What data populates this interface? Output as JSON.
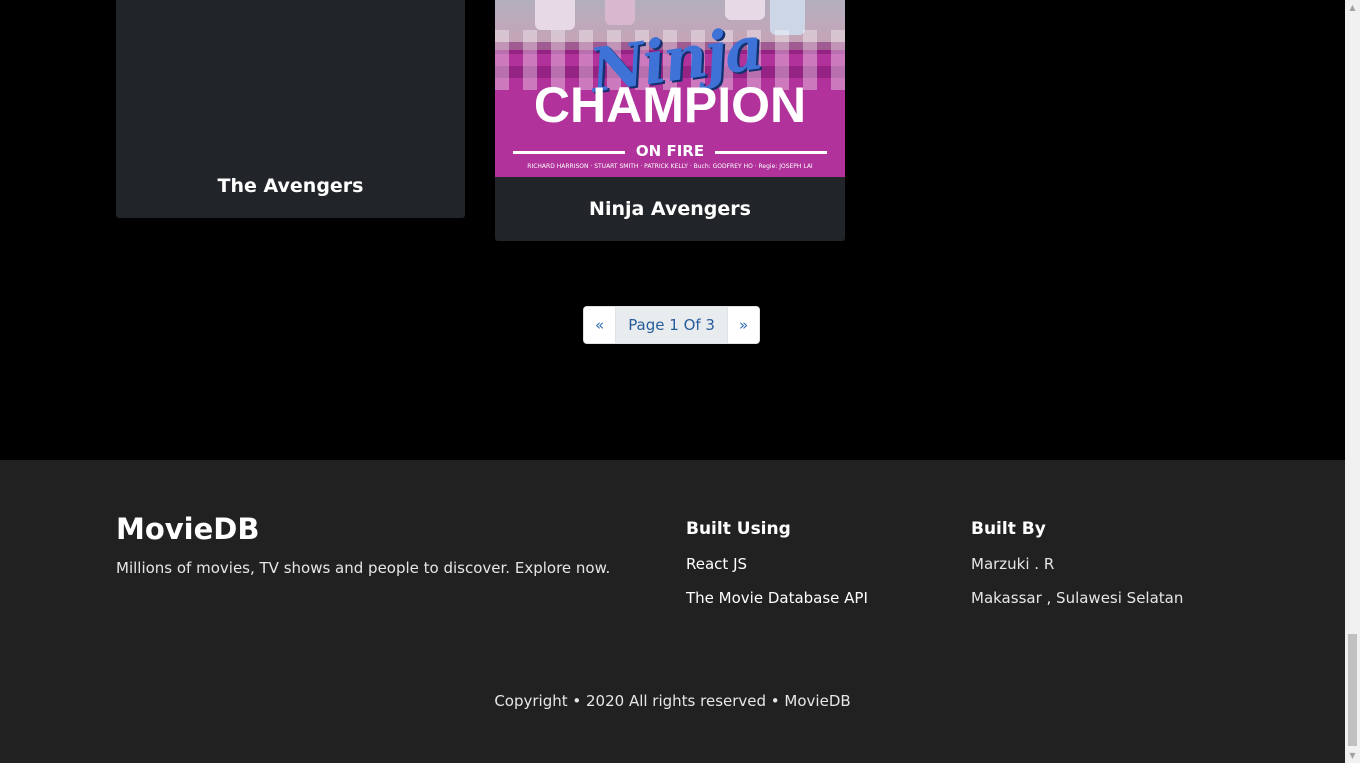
{
  "movies": [
    {
      "title": "The Avengers"
    },
    {
      "title": "Ninja Avengers",
      "poster": {
        "title_script": "Ninja",
        "title_main": "CHAMPION",
        "title_sub": "ON FIRE",
        "credits": "RICHARD HARRISON · STUART SMITH · PATRICK KELLY · Buch: GODFREY HO · Regie: JOSEPH LAI"
      }
    }
  ],
  "pagination": {
    "prev": "«",
    "current": "Page 1 Of 3",
    "next": "»"
  },
  "footer": {
    "brand": "MovieDB",
    "tagline": "Millions of movies, TV shows and people to discover. Explore now.",
    "built_using": {
      "title": "Built Using",
      "items": [
        "React JS",
        "The Movie Database API"
      ]
    },
    "built_by": {
      "title": "Built By",
      "items": [
        "Marzuki . R",
        "Makassar , Sulawesi Selatan"
      ]
    },
    "copyright": "Copyright • 2020 All rights reserved • MovieDB"
  },
  "colors": {
    "card_bg": "#212429",
    "footer_bg": "#212121",
    "link": "#2f6fb5",
    "page_bg": "#000000"
  }
}
